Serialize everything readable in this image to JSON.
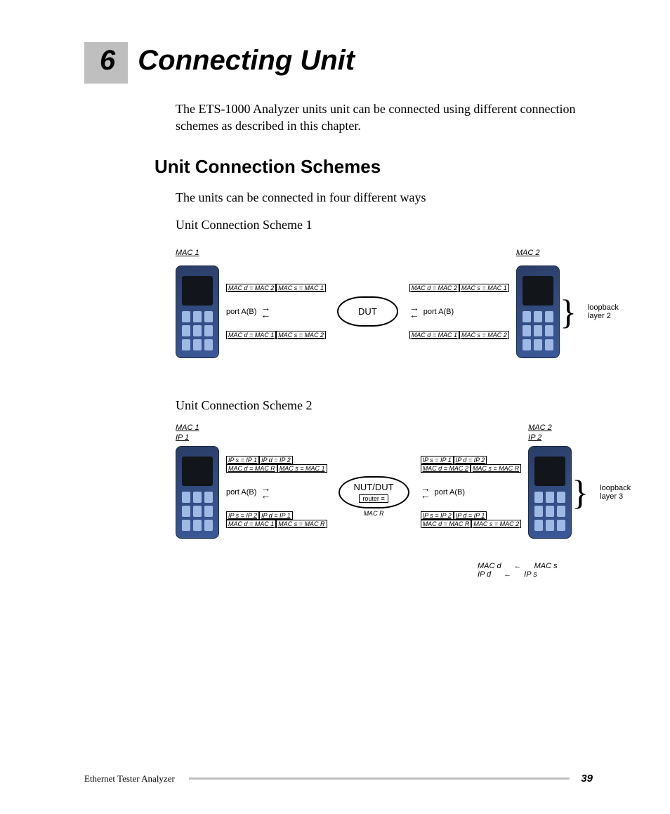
{
  "chapter": {
    "number": "6",
    "title": "Connecting Unit"
  },
  "intro": "The ETS-1000 Analyzer units unit can be connected using different connection schemes as described in this chapter.",
  "section_title": "Unit Connection Schemes",
  "section_lead": "The units can be connected in four different ways",
  "scheme1": {
    "caption": "Unit Connection Scheme 1",
    "left_device_label": "MAC 1",
    "right_device_label": "MAC 2",
    "center": "DUT",
    "port_label": "port A(B)",
    "top_left_1": "MAC d = MAC 2",
    "top_left_2": "MAC s = MAC 1",
    "bot_left_1": "MAC d = MAC 1",
    "bot_left_2": "MAC s = MAC 2",
    "top_right_1": "MAC d = MAC 2",
    "top_right_2": "MAC s = MAC 1",
    "bot_right_1": "MAC d = MAC 1",
    "bot_right_2": "MAC s = MAC 2",
    "loopback": "loopback layer 2"
  },
  "scheme2": {
    "caption": "Unit Connection Scheme 2",
    "left_device_label": "MAC 1",
    "left_ip_label": "IP 1",
    "right_device_label": "MAC 2",
    "right_ip_label": "IP 2",
    "center": "NUT/DUT",
    "center_sub": "router",
    "center_mac": "MAC R",
    "port_label": "port A(B)",
    "l_ip_top_1": "IP s = IP 1",
    "l_ip_top_2": "IP d = IP 2",
    "l_mac_top_1": "MAC d = MAC R",
    "l_mac_top_2": "MAC s = MAC 1",
    "l_ip_bot_1": "IP s = IP 2",
    "l_ip_bot_2": "IP d = IP 1",
    "l_mac_bot_1": "MAC d = MAC 1",
    "l_mac_bot_2": "MAC s = MAC R",
    "r_ip_top_1": "IP s = IP 1",
    "r_ip_top_2": "IP d = IP 2",
    "r_mac_top_1": "MAC d = MAC 2",
    "r_mac_top_2": "MAC s = MAC R",
    "r_ip_bot_1": "IP s = IP 2",
    "r_ip_bot_2": "IP d = IP 1",
    "r_mac_bot_1": "MAC d = MAC R",
    "r_mac_bot_2": "MAC s = MAC 2",
    "loopback": "loopback layer 3",
    "legend_macd": "MAC d",
    "legend_macs": "MAC s",
    "legend_ipd": "IP d",
    "legend_ips": "IP s"
  },
  "footer": {
    "doc_title": "Ethernet Tester Analyzer",
    "page_number": "39"
  }
}
